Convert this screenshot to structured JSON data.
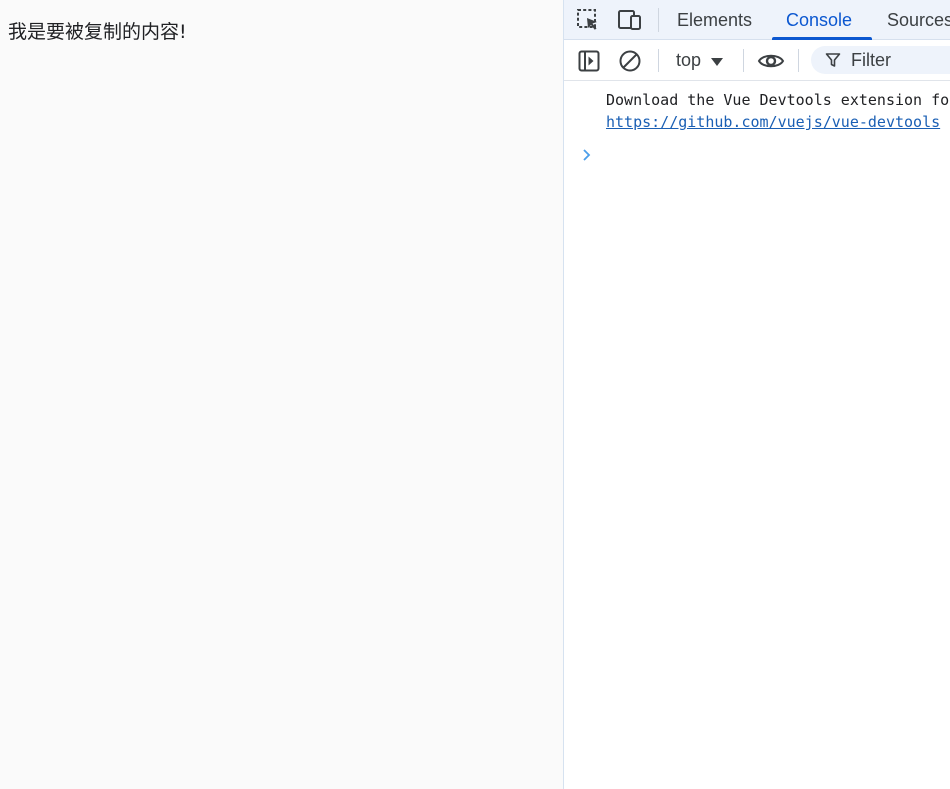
{
  "page": {
    "text": "我是要被复制的内容!"
  },
  "devtools": {
    "tabs": [
      {
        "label": "Elements",
        "active": false
      },
      {
        "label": "Console",
        "active": true
      },
      {
        "label": "Sources",
        "active": false
      }
    ],
    "toolbar": {
      "context": "top",
      "filter_placeholder": "Filter"
    },
    "console": {
      "message": "Download the Vue Devtools extension for",
      "link": "https://github.com/vuejs/vue-devtools"
    },
    "icons": {
      "inspect": "inspect-element-icon",
      "device": "device-toolbar-icon",
      "sidebar": "show-sidebar-icon",
      "clear": "clear-console-icon",
      "eye": "live-expression-eye-icon",
      "filter": "filter-funnel-icon",
      "prompt": "console-prompt-chevron-icon"
    },
    "colors": {
      "accent": "#0b57d0",
      "link": "#1a5fb4",
      "tabbar_bg": "#eef3fb"
    }
  }
}
